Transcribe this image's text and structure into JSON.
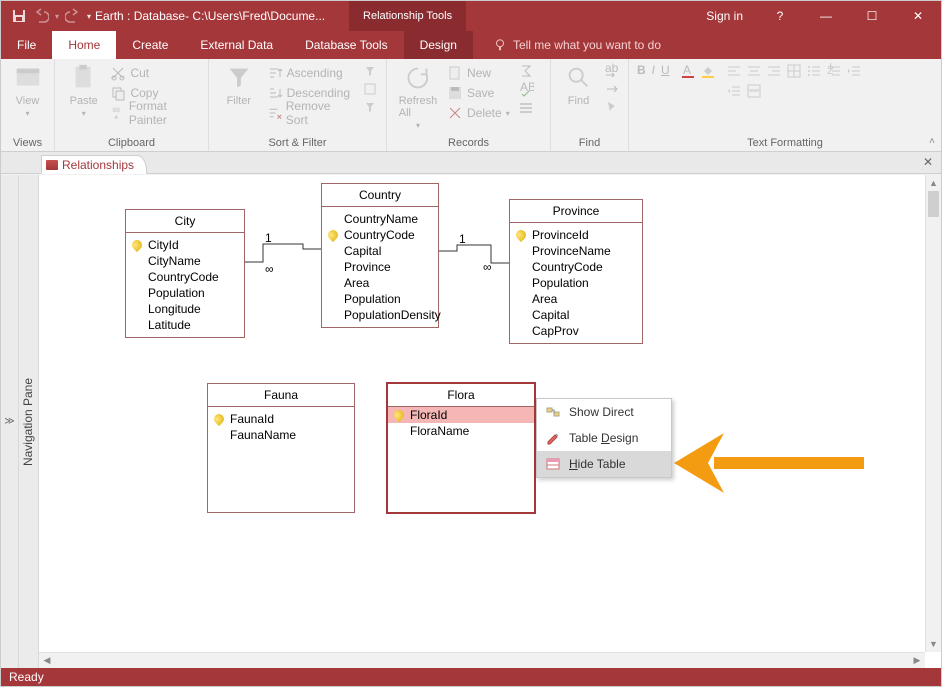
{
  "title": "Earth : Database- C:\\Users\\Fred\\Docume...",
  "contextual_tab_group": "Relationship Tools",
  "signin": "Sign in",
  "window_buttons": {
    "help": "?",
    "min": "—",
    "max": "☐",
    "close": "✕"
  },
  "qat": {
    "save": "save",
    "undo": "undo",
    "redo": "redo",
    "more": "▾"
  },
  "menu": {
    "file": "File",
    "home": "Home",
    "create": "Create",
    "external": "External Data",
    "dbtools": "Database Tools",
    "design": "Design",
    "tellme": "Tell me what you want to do"
  },
  "ribbon": {
    "views": {
      "label": "Views",
      "btn": "View"
    },
    "clipboard": {
      "label": "Clipboard",
      "paste": "Paste",
      "cut": "Cut",
      "copy": "Copy",
      "fmt": "Format Painter"
    },
    "sortfilter": {
      "label": "Sort & Filter",
      "filter": "Filter",
      "asc": "Ascending",
      "desc": "Descending",
      "remove": "Remove Sort"
    },
    "records": {
      "label": "Records",
      "refresh": "Refresh\nAll",
      "new": "New",
      "save": "Save",
      "delete": "Delete"
    },
    "find": {
      "label": "Find",
      "find": "Find"
    },
    "textfmt": {
      "label": "Text Formatting",
      "b": "B",
      "i": "I",
      "u": "U",
      "a": "A"
    }
  },
  "doc_tab": "Relationships",
  "navpane_label": "Navigation Pane",
  "shutter": "≫",
  "tables": {
    "city": {
      "title": "City",
      "fields": [
        "CityId",
        "CityName",
        "CountryCode",
        "Population",
        "Longitude",
        "Latitude"
      ],
      "pk": 0
    },
    "country": {
      "title": "Country",
      "fields": [
        "CountryName",
        "CountryCode",
        "Capital",
        "Province",
        "Area",
        "Population",
        "PopulationDensity"
      ],
      "pk": 1
    },
    "province": {
      "title": "Province",
      "fields": [
        "ProvinceId",
        "ProvinceName",
        "CountryCode",
        "Population",
        "Area",
        "Capital",
        "CapProv"
      ],
      "pk": 0
    },
    "fauna": {
      "title": "Fauna",
      "fields": [
        "FaunaId",
        "FaunaName"
      ],
      "pk": 0
    },
    "flora": {
      "title": "Flora",
      "fields": [
        "FloraId",
        "FloraName"
      ],
      "pk": 0
    }
  },
  "relations": {
    "one": "1",
    "many": "∞"
  },
  "context_menu": {
    "show": "Show Direct",
    "design": "Table Design",
    "hide": "Hide Table"
  },
  "status": "Ready"
}
